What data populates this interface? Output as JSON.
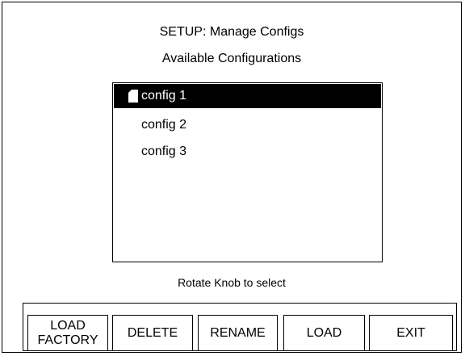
{
  "header": {
    "title": "SETUP: Manage Configs",
    "subtitle": "Available Configurations"
  },
  "config_list": {
    "items": [
      {
        "label": "config 1",
        "selected": true
      },
      {
        "label": "config 2",
        "selected": false
      },
      {
        "label": "config 3",
        "selected": false
      }
    ]
  },
  "hint": "Rotate Knob to select",
  "buttons": {
    "load_factory": "LOAD\nFACTORY",
    "delete": "DELETE",
    "rename": "RENAME",
    "load": "LOAD",
    "exit": "EXIT"
  }
}
